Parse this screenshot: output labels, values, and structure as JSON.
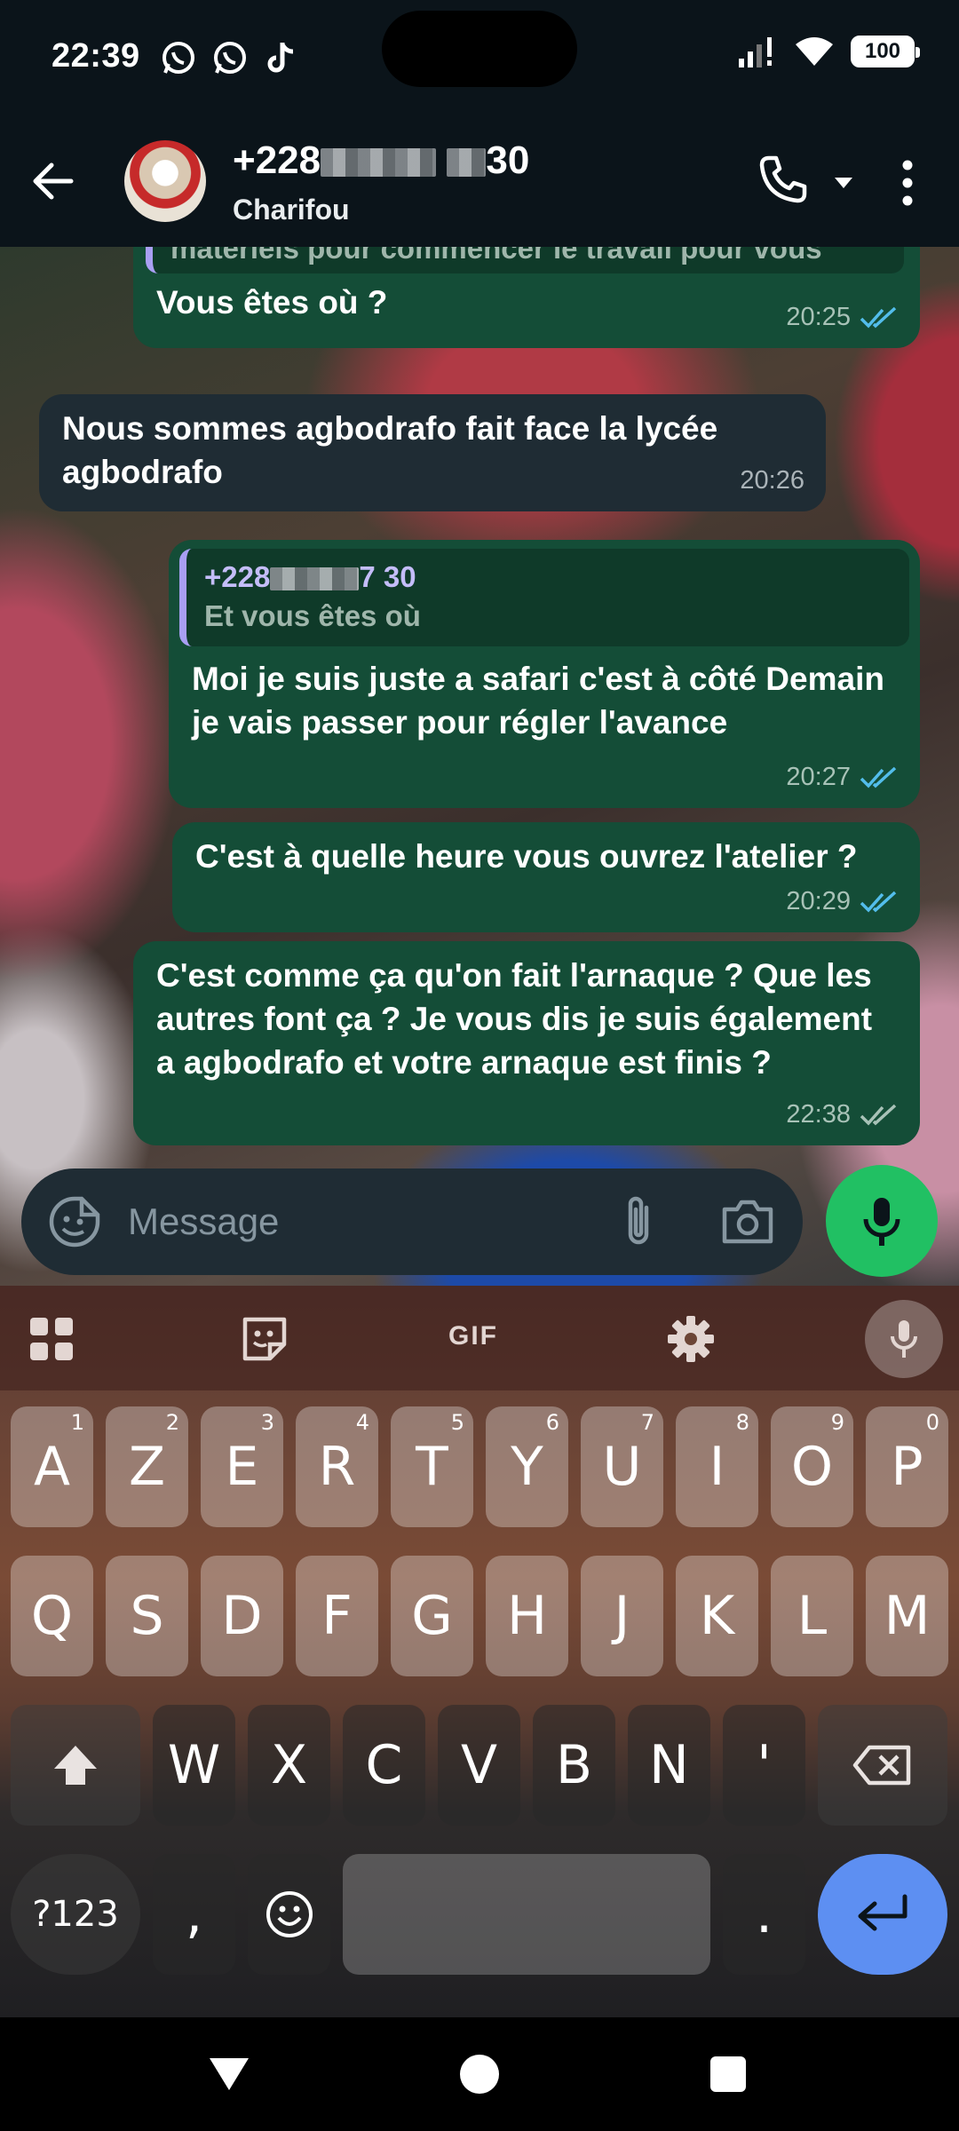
{
  "status_bar": {
    "time": "22:39",
    "battery": "100"
  },
  "header": {
    "number_prefix": "+228",
    "number_suffix": "30",
    "name": "Charifou"
  },
  "messages": [
    {
      "direction": "out",
      "quote_tail": "matériels pour commencer le travail pour vous",
      "text": "Vous êtes où ?",
      "time": "20:25",
      "read": true
    },
    {
      "direction": "in",
      "text": "Nous sommes agbodrafo fait face la lycée agbodrafo",
      "time": "20:26"
    },
    {
      "direction": "out",
      "quote_sender_prefix": "+228",
      "quote_sender_suffix": "7 30",
      "quote_text": "Et vous êtes où",
      "text": "Moi je suis juste a safari c'est à côté Demain je vais passer pour régler l'avance",
      "time": "20:27",
      "read": true
    },
    {
      "direction": "out",
      "text": "C'est à quelle heure vous ouvrez l'atelier ?",
      "time": "20:29",
      "read": true
    },
    {
      "direction": "out",
      "text": "C'est comme ça qu'on fait l'arnaque ? Que les autres font ça ? Je vous dis je suis également a agbodrafo et votre arnaque est finis ?",
      "time": "22:38",
      "read": false
    }
  ],
  "composer": {
    "placeholder": "Message"
  },
  "keyboard": {
    "toolbar_gif": "GIF",
    "row1": [
      "A",
      "Z",
      "E",
      "R",
      "T",
      "Y",
      "U",
      "I",
      "O",
      "P"
    ],
    "row1_hints": [
      "1",
      "2",
      "3",
      "4",
      "5",
      "6",
      "7",
      "8",
      "9",
      "0"
    ],
    "row2": [
      "Q",
      "S",
      "D",
      "F",
      "G",
      "H",
      "J",
      "K",
      "L",
      "M"
    ],
    "row3": [
      "W",
      "X",
      "C",
      "V",
      "B",
      "N",
      "'"
    ],
    "symbols_key": "?123",
    "comma_key": ",",
    "period_key": "."
  },
  "colors": {
    "outgoing": "#144d37",
    "incoming": "#1f2c34",
    "read_ticks": "#53bdeb",
    "mic": "#21c063",
    "enter": "#5d8ff2"
  }
}
